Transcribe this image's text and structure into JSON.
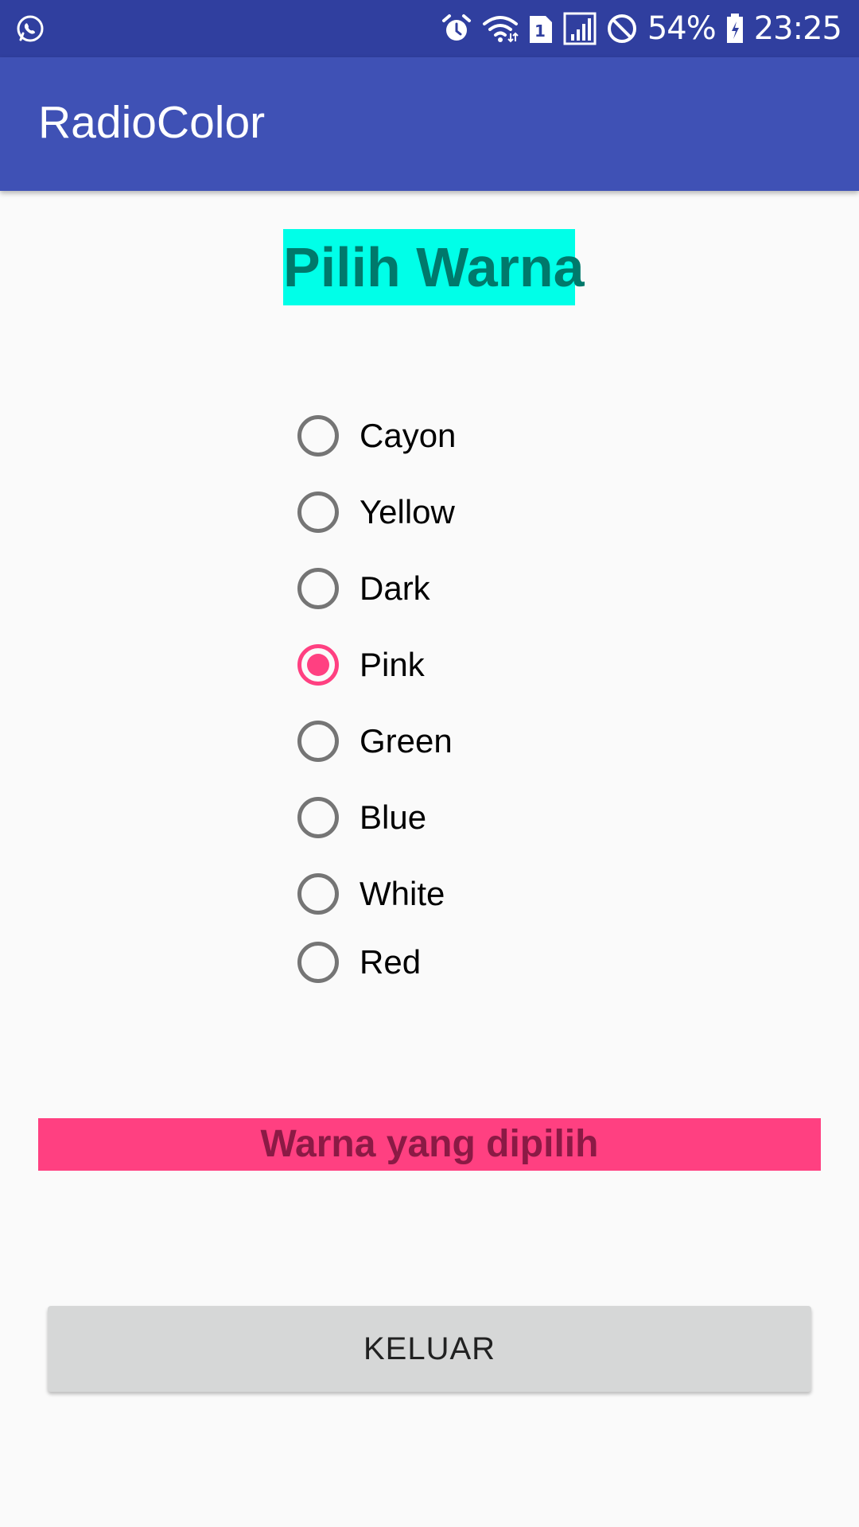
{
  "status_bar": {
    "battery_text": "54%",
    "time": "23:25",
    "sim_badge": "1",
    "icons": [
      "whatsapp-icon",
      "alarm-icon",
      "wifi-icon",
      "sim-icon",
      "signal-icon",
      "do-not-disturb-icon",
      "battery-icon"
    ],
    "background": "#303f9f"
  },
  "app_bar": {
    "title": "RadioColor",
    "background": "#3f51b5"
  },
  "heading": {
    "text": "Pilih Warna",
    "background": "#00ffe8",
    "text_color": "#00796b"
  },
  "radio_group": {
    "selected": "Pink",
    "options": [
      {
        "label": "Cayon",
        "checked": false
      },
      {
        "label": "Yellow",
        "checked": false
      },
      {
        "label": "Dark",
        "checked": false
      },
      {
        "label": "Pink",
        "checked": true
      },
      {
        "label": "Green",
        "checked": false
      },
      {
        "label": "Blue",
        "checked": false
      },
      {
        "label": "White",
        "checked": false
      },
      {
        "label": "Red",
        "checked": false
      }
    ],
    "accent_color": "#ff4081"
  },
  "result": {
    "text": "Warna yang dipilih",
    "background": "#ff4081",
    "text_color": "#8b1a45"
  },
  "exit_button": {
    "label": "KELUAR"
  }
}
